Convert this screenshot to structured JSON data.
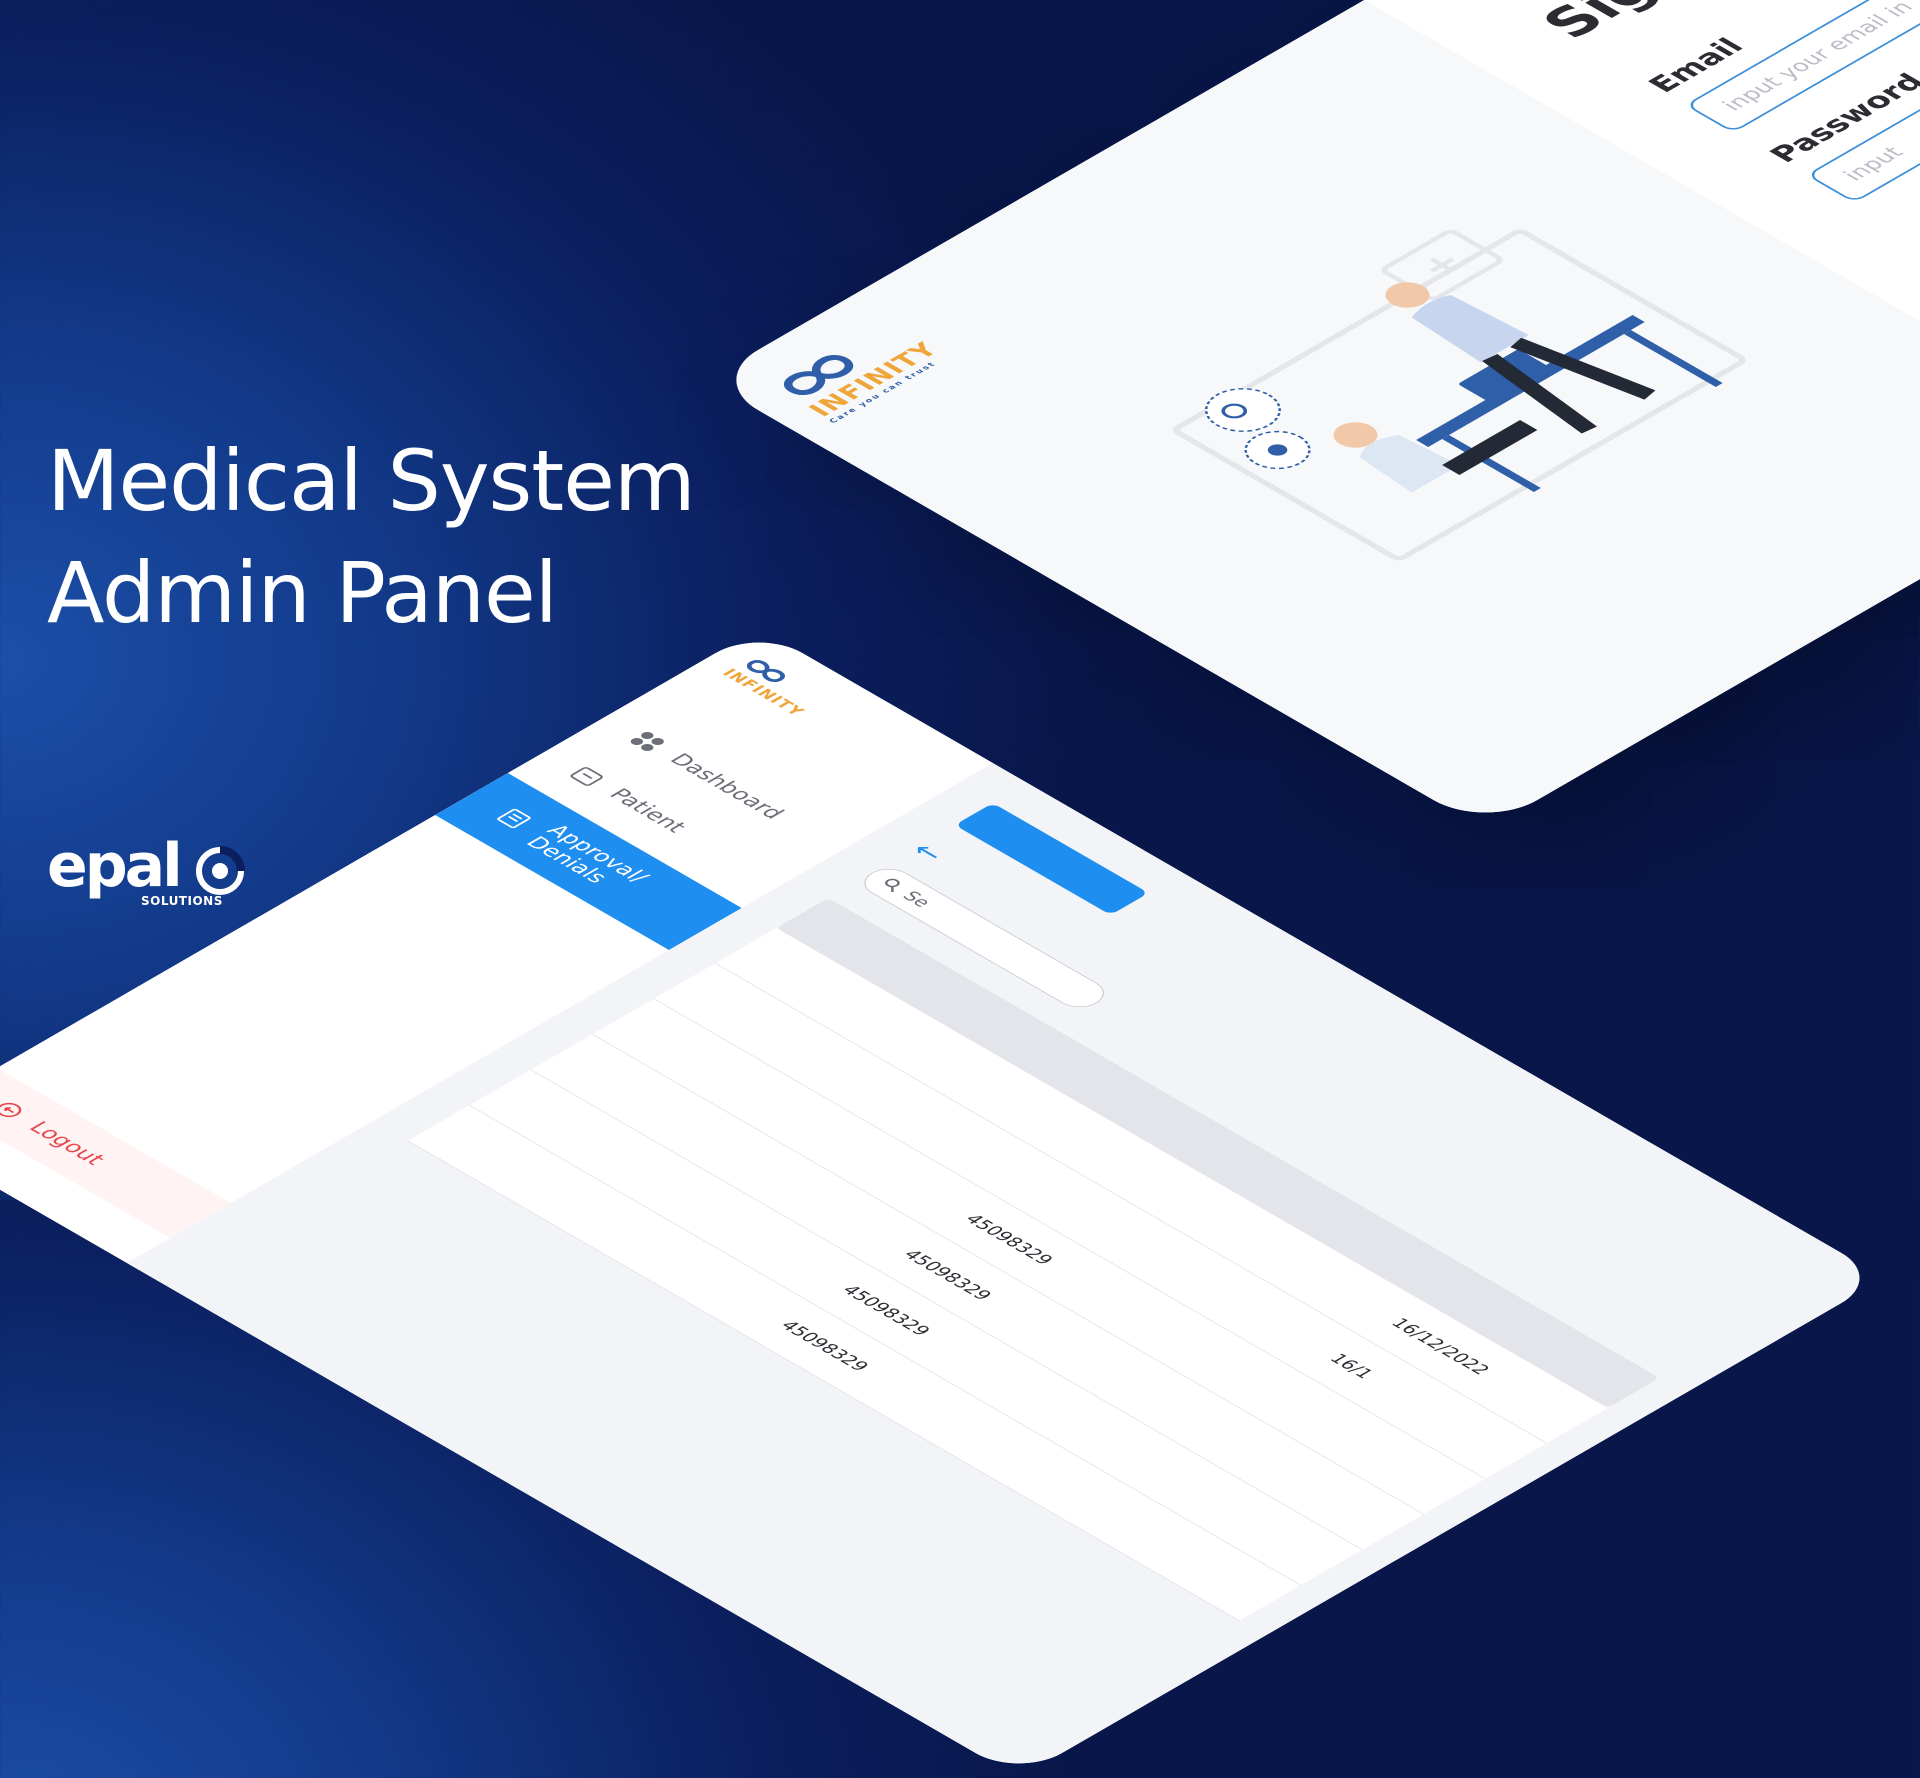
{
  "hero": {
    "line1": "Medical System",
    "line2": "Admin Panel"
  },
  "brand": {
    "word": "epal",
    "sub": "SOLUTIONS"
  },
  "login": {
    "logo_word": "INFINITY",
    "logo_tagline": "Care you can trust",
    "title": "Sign in To",
    "email_label": "Email",
    "email_placeholder": "input your email in",
    "password_label": "Password",
    "password_placeholder": "input"
  },
  "dashboard": {
    "logo_word": "INFINITY",
    "back_icon": "arrow-left-icon",
    "search_placeholder": "Se",
    "nav": [
      {
        "label": "Dashboard",
        "icon": "grid-icon"
      },
      {
        "label": "Patient",
        "icon": "patient-card-icon"
      },
      {
        "label": "Approval/\nDenials",
        "icon": "document-icon",
        "active": true
      }
    ],
    "logout_label": "Logout",
    "rows": [
      {
        "id": "",
        "date": "16/12/2022"
      },
      {
        "id": "",
        "date": "16/1"
      },
      {
        "id": "45098329",
        "date": ""
      },
      {
        "id": "45098329",
        "date": ""
      },
      {
        "id": "45098329",
        "date": ""
      },
      {
        "id": "45098329",
        "date": ""
      }
    ]
  },
  "colors": {
    "accent": "#1e8ef0",
    "logout": "#e5484d",
    "background": "#0b1f5e"
  }
}
